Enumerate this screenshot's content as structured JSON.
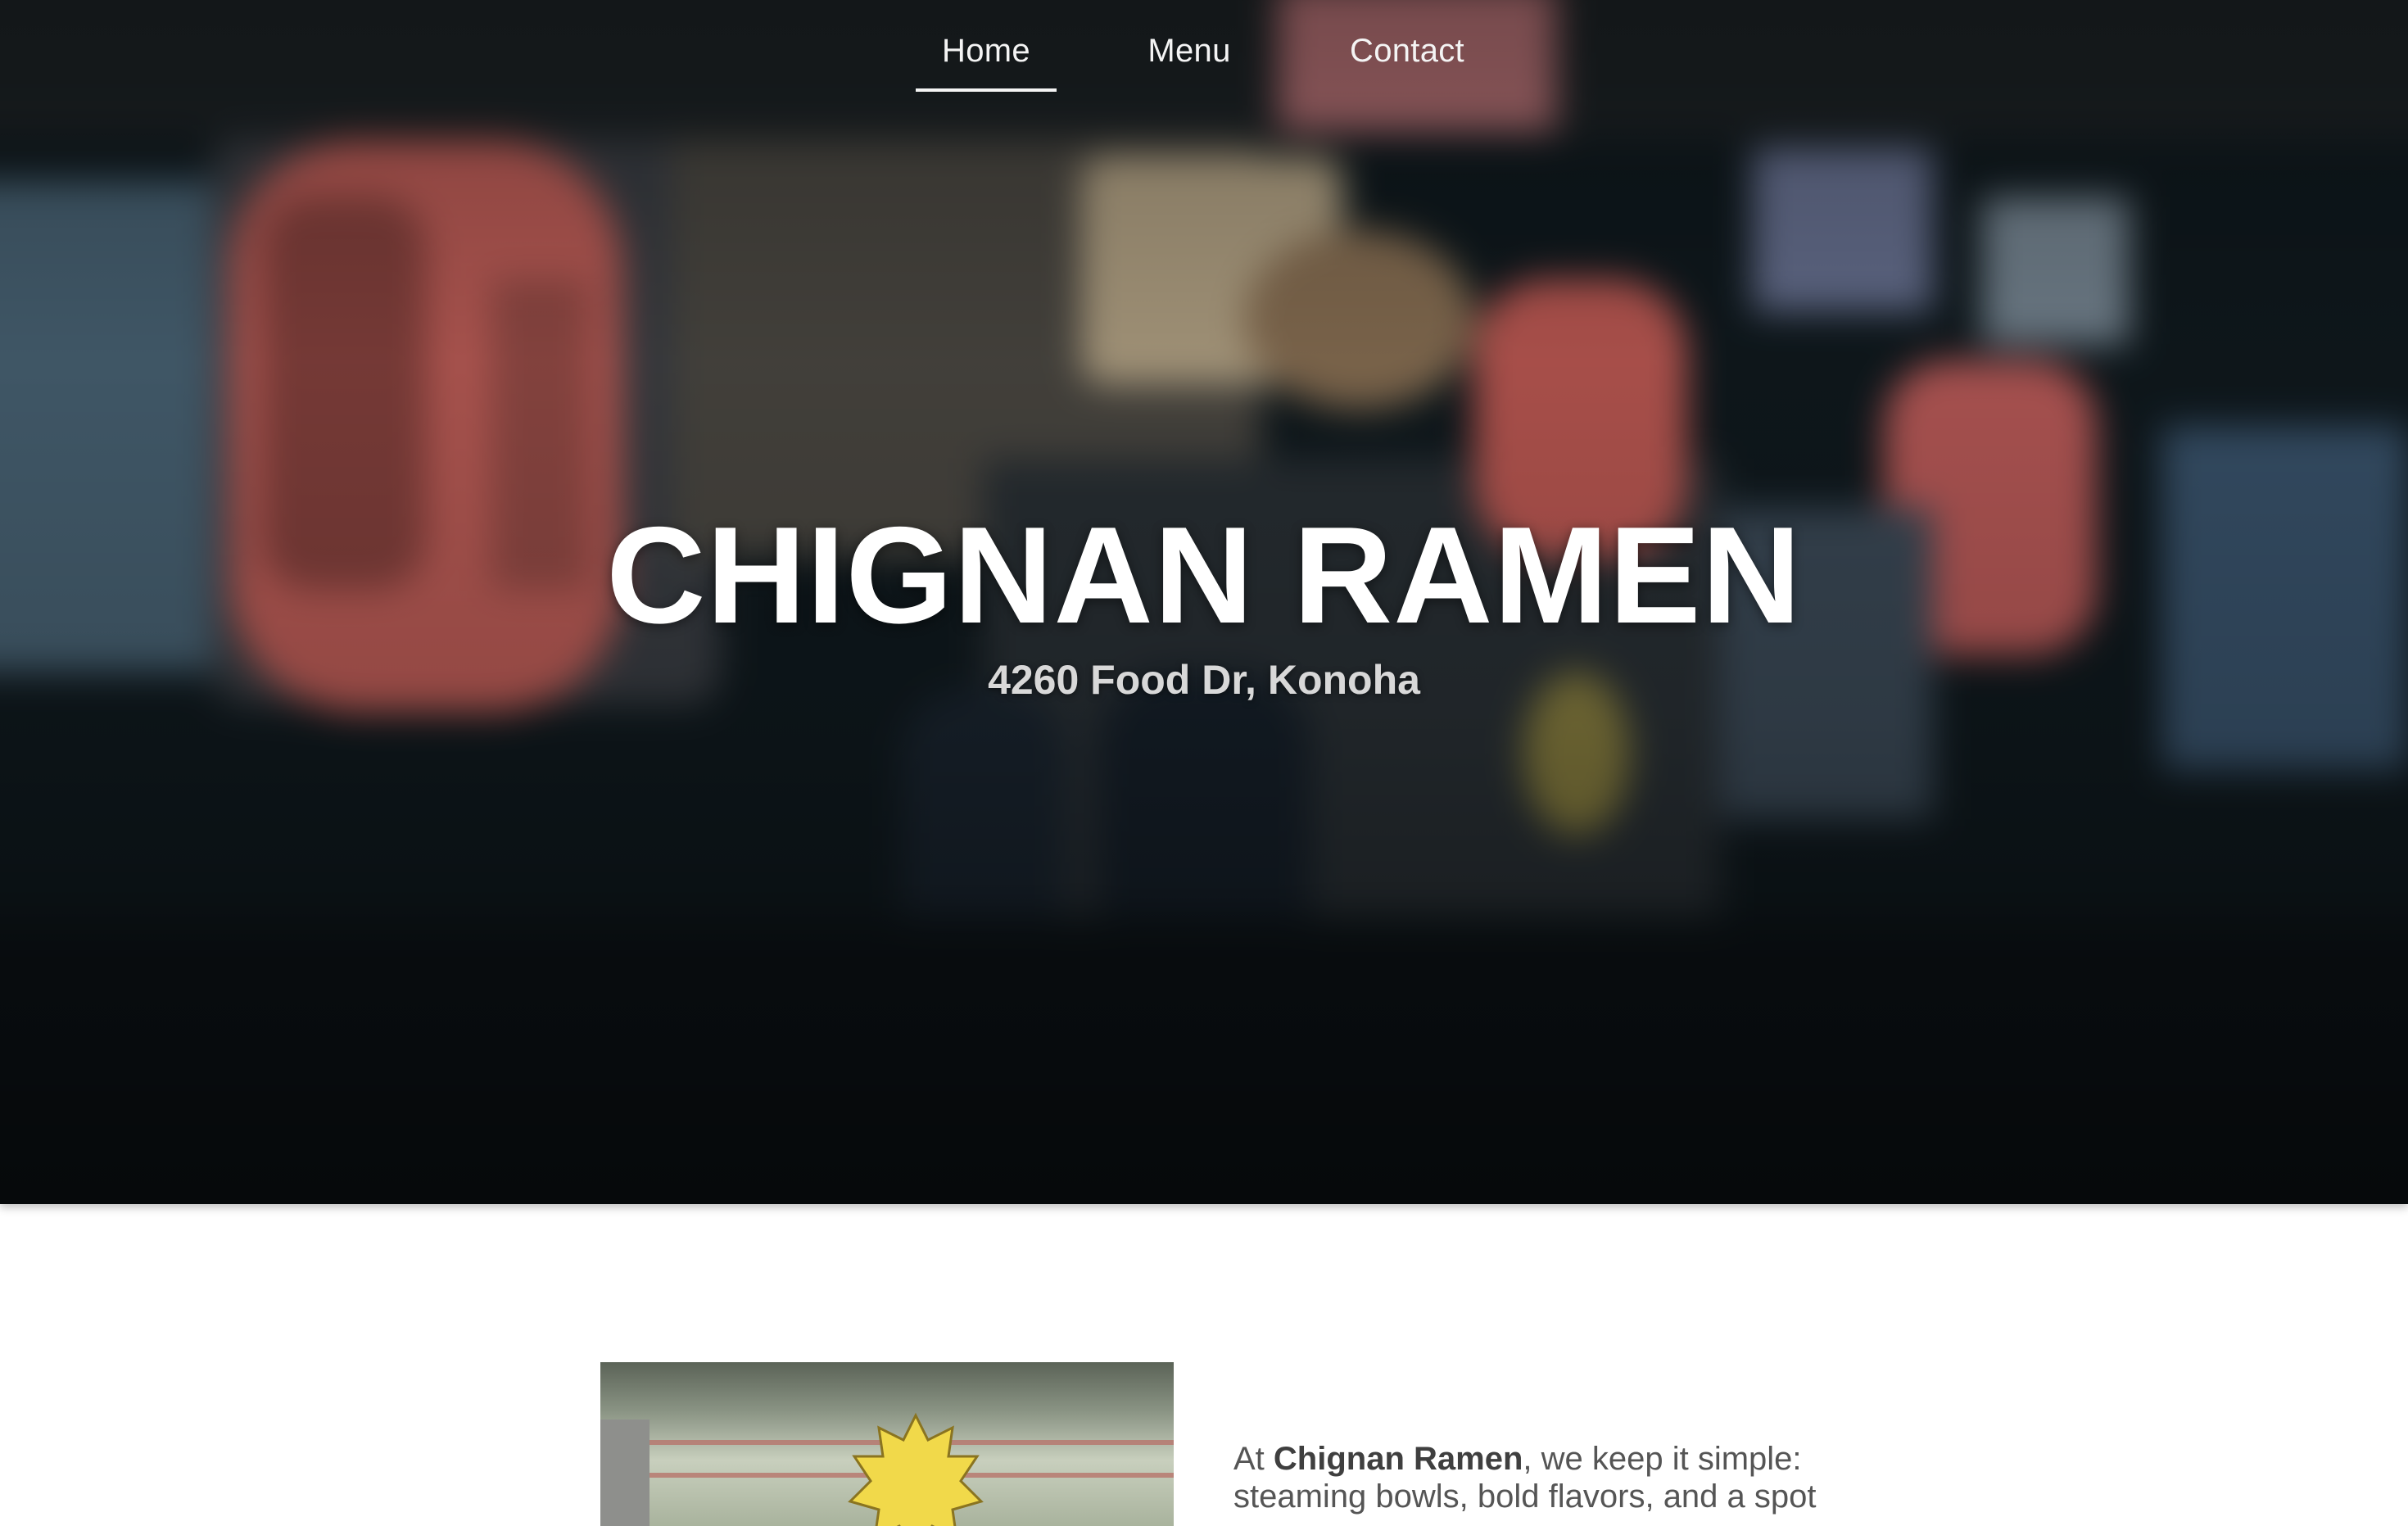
{
  "nav": {
    "items": [
      {
        "label": "Home",
        "active": true
      },
      {
        "label": "Menu",
        "active": false
      },
      {
        "label": "Contact",
        "active": false
      }
    ]
  },
  "hero": {
    "title": "CHIGNAN RAMEN",
    "address": "4260 Food Dr, Konoha"
  },
  "about": {
    "intro": "At ",
    "brand": "Chignan Ramen",
    "text": ", we keep it simple: steaming bowls, bold flavors, and a spot"
  },
  "colors": {
    "hero_overlay": "#0b1114",
    "lantern": "#c8605a",
    "nav_text": "#f4f4f4",
    "body_text": "#555555"
  }
}
